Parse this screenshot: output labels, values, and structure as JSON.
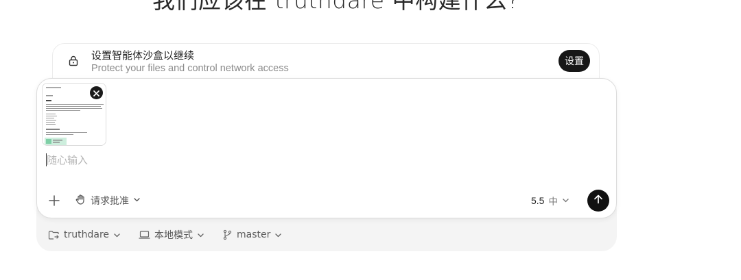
{
  "heading": "我们应该在 truthdare 中构建什么?",
  "sandbox": {
    "title": "设置智能体沙盒以继续",
    "subtitle": "Protect your files and control network access",
    "button_label": "设置"
  },
  "composer": {
    "placeholder": "随心输入",
    "approval_label": "请求批准",
    "model_version": "5.5",
    "effort_label": "中"
  },
  "meta": {
    "project": "truthdare",
    "mode": "本地模式",
    "branch": "master"
  },
  "icons": {
    "lock": "lock-icon",
    "plus": "plus-icon",
    "hand": "hand-icon",
    "send": "arrow-up-icon",
    "remove": "close-icon",
    "folder": "folder-icon",
    "laptop": "laptop-icon",
    "branch": "git-branch-icon",
    "chevron": "chevron-down-icon"
  },
  "colors": {
    "send_button": "#111111",
    "setup_button": "#161616",
    "panel": "#f4f4f4"
  }
}
